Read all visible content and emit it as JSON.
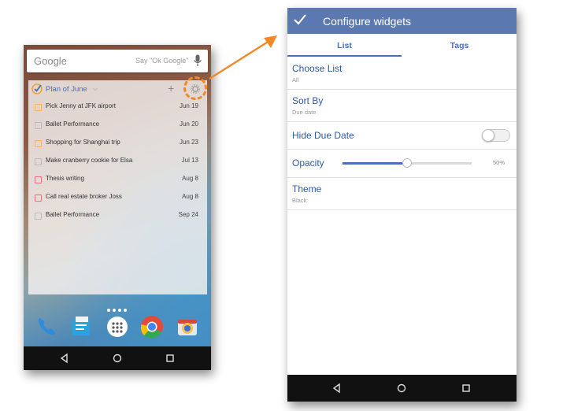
{
  "launcher": {
    "google": {
      "logo": "Google",
      "hint": "Say \"Ok Google\""
    },
    "widget": {
      "title": "Plan of June",
      "tasks": [
        {
          "name": "Pick Jenny at JFK airport",
          "due": "Jun 19",
          "color": "#f2b37a"
        },
        {
          "name": "Ballet Performance",
          "due": "Jun 20",
          "color": "#b9bcc4"
        },
        {
          "name": "Shopping for Shanghai trip",
          "due": "Jun 23",
          "color": "#f2b37a"
        },
        {
          "name": "Make cranberry cookie for Elsa",
          "due": "Jul 13",
          "color": "#b9bcc4"
        },
        {
          "name": "Thesis writing",
          "due": "Aug 8",
          "color": "#e8737a"
        },
        {
          "name": "Call real estate broker Joss",
          "due": "Aug 8",
          "color": "#e8737a"
        },
        {
          "name": "Ballet Performance",
          "due": "Sep 24",
          "color": "#b9bcc4"
        }
      ]
    },
    "dock_icons": [
      "phone-icon",
      "messages-icon",
      "app-drawer-icon",
      "chrome-icon",
      "camera-icon"
    ]
  },
  "config": {
    "title": "Configure widgets",
    "tabs": [
      {
        "label": "List",
        "active": true
      },
      {
        "label": "Tags",
        "active": false
      }
    ],
    "rows": {
      "choose_list": {
        "title": "Choose List",
        "value": "All"
      },
      "sort_by": {
        "title": "Sort By",
        "value": "Due date"
      },
      "hide_due_date": {
        "title": "Hide Due Date",
        "enabled": false
      },
      "opacity": {
        "title": "Opacity",
        "value": "50%",
        "level": 0.5
      },
      "theme": {
        "title": "Theme",
        "value": "Black"
      }
    }
  },
  "colors": {
    "accent": "#5b79b0",
    "highlight": "#f08a28"
  }
}
